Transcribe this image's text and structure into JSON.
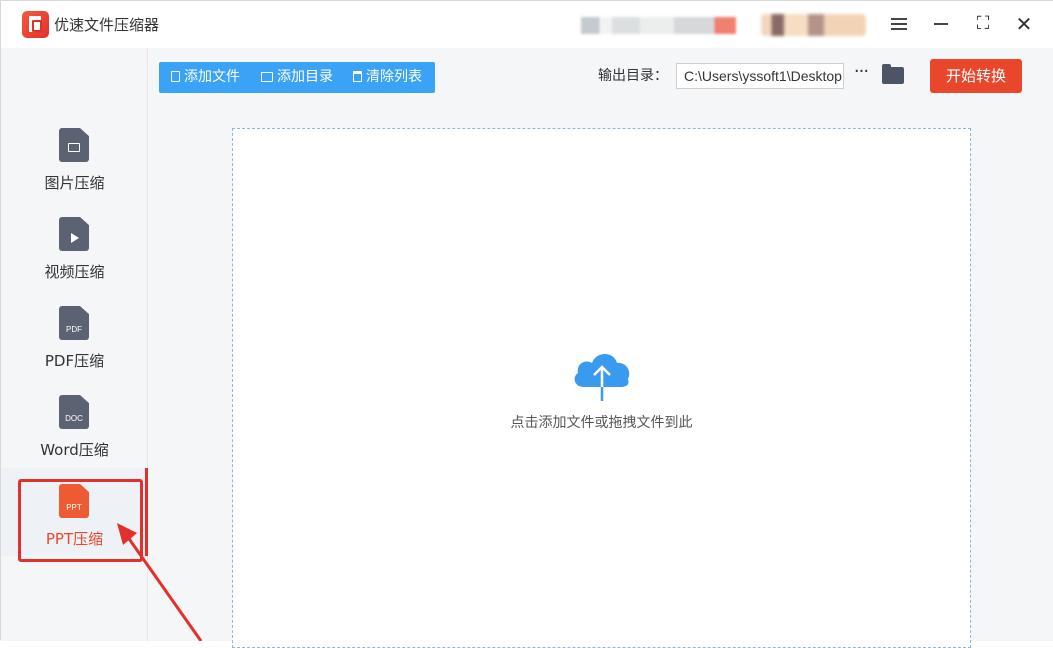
{
  "app": {
    "title": "优速文件压缩器",
    "accent": "#e8472c",
    "toolbar_blue": "#3aa3f5"
  },
  "window_controls": {
    "menu": "menu-icon",
    "minimize": "minimize-icon",
    "maximize": "⛶",
    "close": "✕"
  },
  "sidebar": {
    "items": [
      {
        "label": "图片压缩",
        "icon": "image-file-icon",
        "badge": ""
      },
      {
        "label": "视频压缩",
        "icon": "video-file-icon",
        "badge": ""
      },
      {
        "label": "PDF压缩",
        "icon": "pdf-file-icon",
        "badge": "PDF"
      },
      {
        "label": "Word压缩",
        "icon": "doc-file-icon",
        "badge": "DOC"
      },
      {
        "label": "PPT压缩",
        "icon": "ppt-file-icon",
        "badge": "PPT",
        "active": true
      }
    ]
  },
  "toolbar": {
    "add_file": "添加文件",
    "add_folder": "添加目录",
    "clear_list": "清除列表",
    "output_label": "输出目录：",
    "output_path": "C:\\Users\\yssoft1\\Desktop",
    "more": "···",
    "start": "开始转换"
  },
  "dropzone": {
    "text": "点击添加文件或拖拽文件到此",
    "icon": "cloud-upload-icon"
  }
}
